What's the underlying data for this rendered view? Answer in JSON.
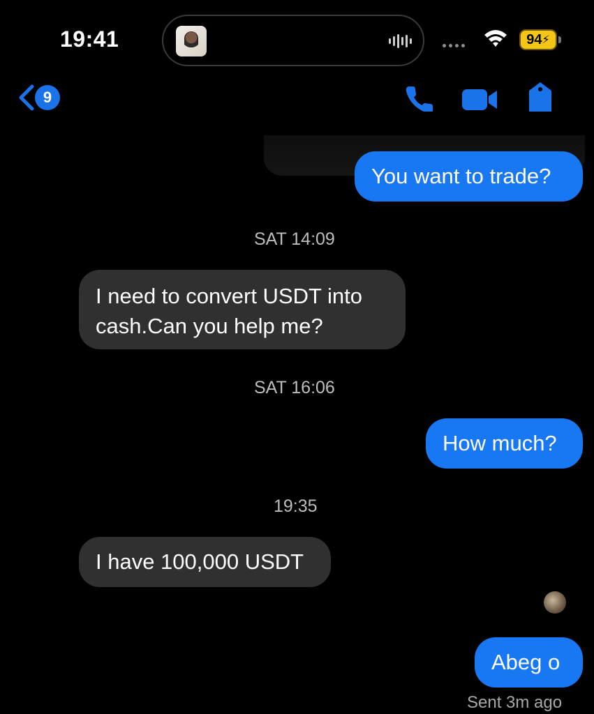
{
  "status_bar": {
    "time": "19:41",
    "battery": "94"
  },
  "header": {
    "back_count": "9"
  },
  "messages": [
    {
      "dir": "out",
      "text": "You want to trade?"
    },
    {
      "timestamp": "SAT 14:09"
    },
    {
      "dir": "in",
      "text": "I need to convert USDT into cash.Can you help me?"
    },
    {
      "timestamp": "SAT 16:06"
    },
    {
      "dir": "out",
      "text": "How much?"
    },
    {
      "timestamp": "19:35"
    },
    {
      "dir": "in",
      "text": "I have 100,000 USDT"
    },
    {
      "dir": "out",
      "text": "Abeg o"
    }
  ],
  "sent_status": "Sent 3m ago",
  "colors": {
    "outgoing": "#1877f2",
    "incoming": "#303030",
    "accent": "#1a73e8"
  }
}
